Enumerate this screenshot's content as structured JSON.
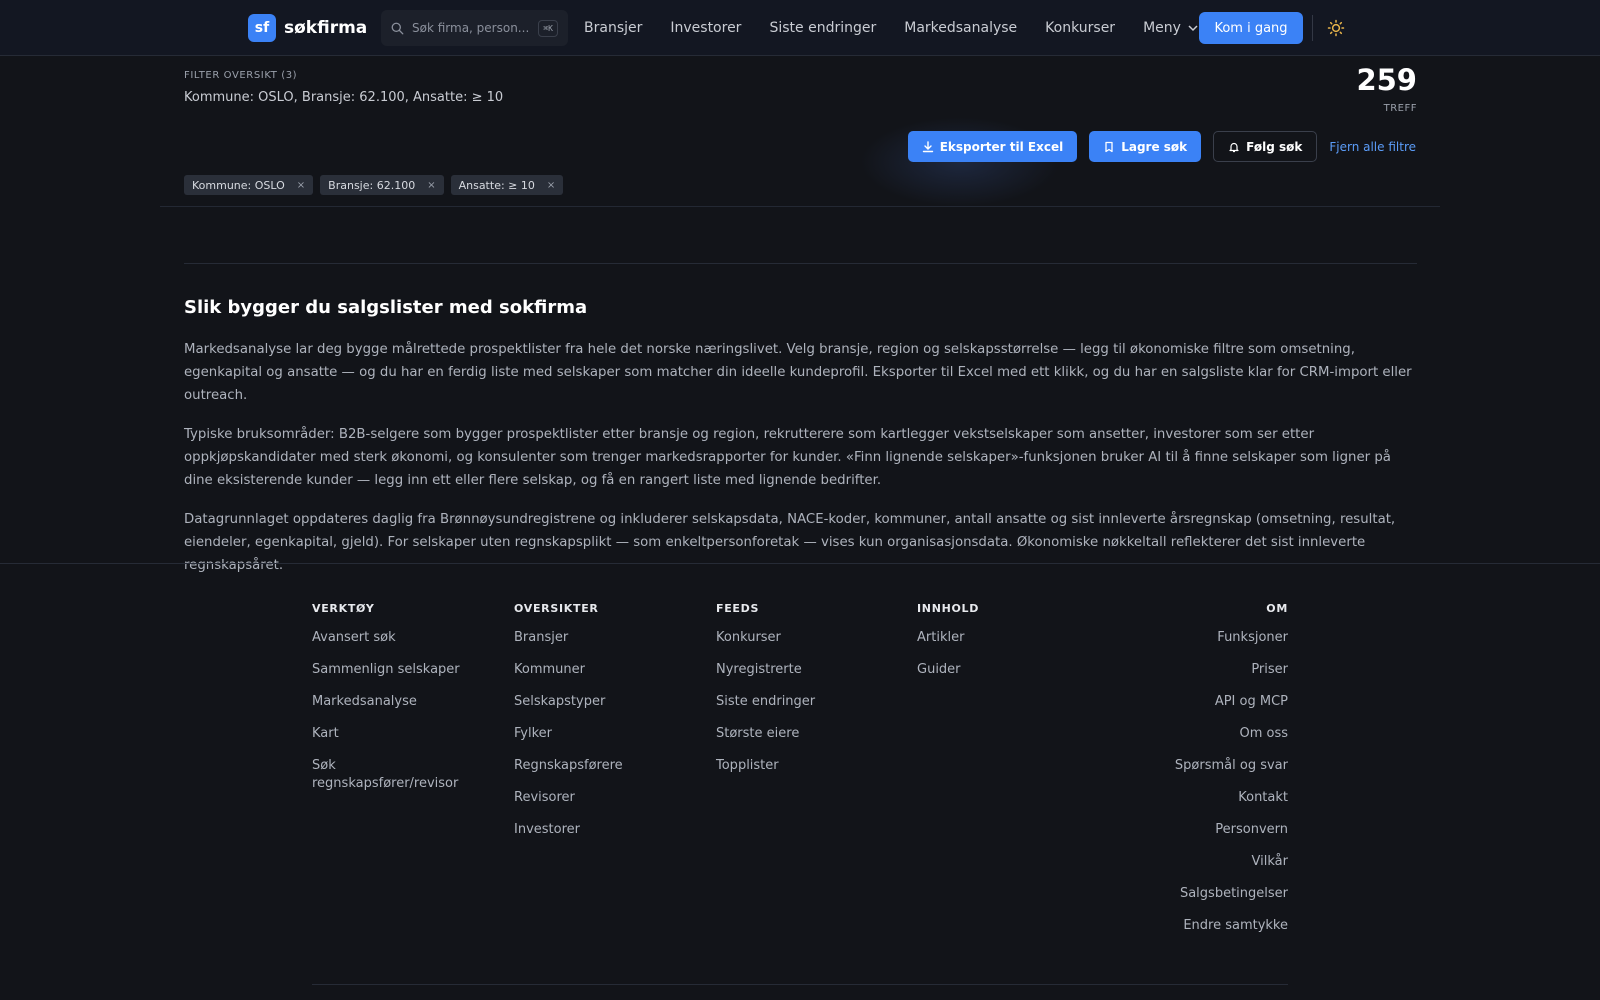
{
  "header": {
    "logo_badge": "sf",
    "logo_text": "søkfirma",
    "search_placeholder": "Søk firma, person...",
    "search_shortcut": "⌘K",
    "nav": [
      "Bransjer",
      "Investorer",
      "Siste endringer",
      "Markedsanalyse",
      "Konkurser",
      "Meny"
    ],
    "cta": "Kom i gang",
    "icons": {
      "search": "search-icon",
      "menu": "chevron-down-icon",
      "theme": "sun-icon"
    }
  },
  "filters": {
    "title": "FILTER OVERSIKT (3)",
    "summary": "Kommune: OSLO, Bransje: 62.100, Ansatte: ≥ 10",
    "count": "259",
    "count_label": "TREFF",
    "actions": {
      "export": "Eksporter til Excel",
      "save": "Lagre søk",
      "follow": "Følg søk",
      "clear": "Fjern alle filtre"
    },
    "chips": [
      "Kommune: OSLO",
      "Bransje: 62.100",
      "Ansatte: ≥ 10"
    ],
    "chip_remove": "×"
  },
  "content": {
    "heading": "Slik bygger du salgslister med sokfirma",
    "paragraphs": [
      "Markedsanalyse lar deg bygge målrettede prospektlister fra hele det norske næringslivet. Velg bransje, region og selskapsstørrelse — legg til økonomiske filtre som omsetning, egenkapital og ansatte — og du har en ferdig liste med selskaper som matcher din ideelle kundeprofil. Eksporter til Excel med ett klikk, og du har en salgsliste klar for CRM-import eller outreach.",
      "Typiske bruksområder: B2B-selgere som bygger prospektlister etter bransje og region, rekrutterere som kartlegger vekstselskaper som ansetter, investorer som ser etter oppkjøpskandidater med sterk økonomi, og konsulenter som trenger markedsrapporter for kunder. «Finn lignende selskaper»-funksjonen bruker AI til å finne selskaper som ligner på dine eksisterende kunder — legg inn ett eller flere selskap, og få en rangert liste med lignende bedrifter.",
      "Datagrunnlaget oppdateres daglig fra Brønnøysundregistrene og inkluderer selskapsdata, NACE-koder, kommuner, antall ansatte og sist innleverte årsregnskap (omsetning, resultat, eiendeler, egenkapital, gjeld). For selskaper uten regnskapsplikt — som enkeltpersonforetak — vises kun organisasjonsdata. Økonomiske nøkkeltall reflekterer det sist innleverte regnskapsåret."
    ]
  },
  "footer": {
    "columns": [
      {
        "title": "VERKTØY",
        "links": [
          "Avansert søk",
          "Sammenlign selskaper",
          "Markedsanalyse",
          "Kart",
          "Søk regnskapsfører/revisor"
        ]
      },
      {
        "title": "OVERSIKTER",
        "links": [
          "Bransjer",
          "Kommuner",
          "Selskapstyper",
          "Fylker",
          "Regnskapsførere",
          "Revisorer",
          "Investorer"
        ]
      },
      {
        "title": "FEEDS",
        "links": [
          "Konkurser",
          "Nyregistrerte",
          "Siste endringer",
          "Største eiere",
          "Topplister"
        ]
      },
      {
        "title": "INNHOLD",
        "links": [
          "Artikler",
          "Guider"
        ]
      },
      {
        "title": "OM",
        "links": [
          "Funksjoner",
          "Priser",
          "API og MCP",
          "Om oss",
          "Spørsmål og svar",
          "Kontakt",
          "Personvern",
          "Vilkår",
          "Salgsbetingelser",
          "Endre samtykke"
        ]
      }
    ]
  }
}
